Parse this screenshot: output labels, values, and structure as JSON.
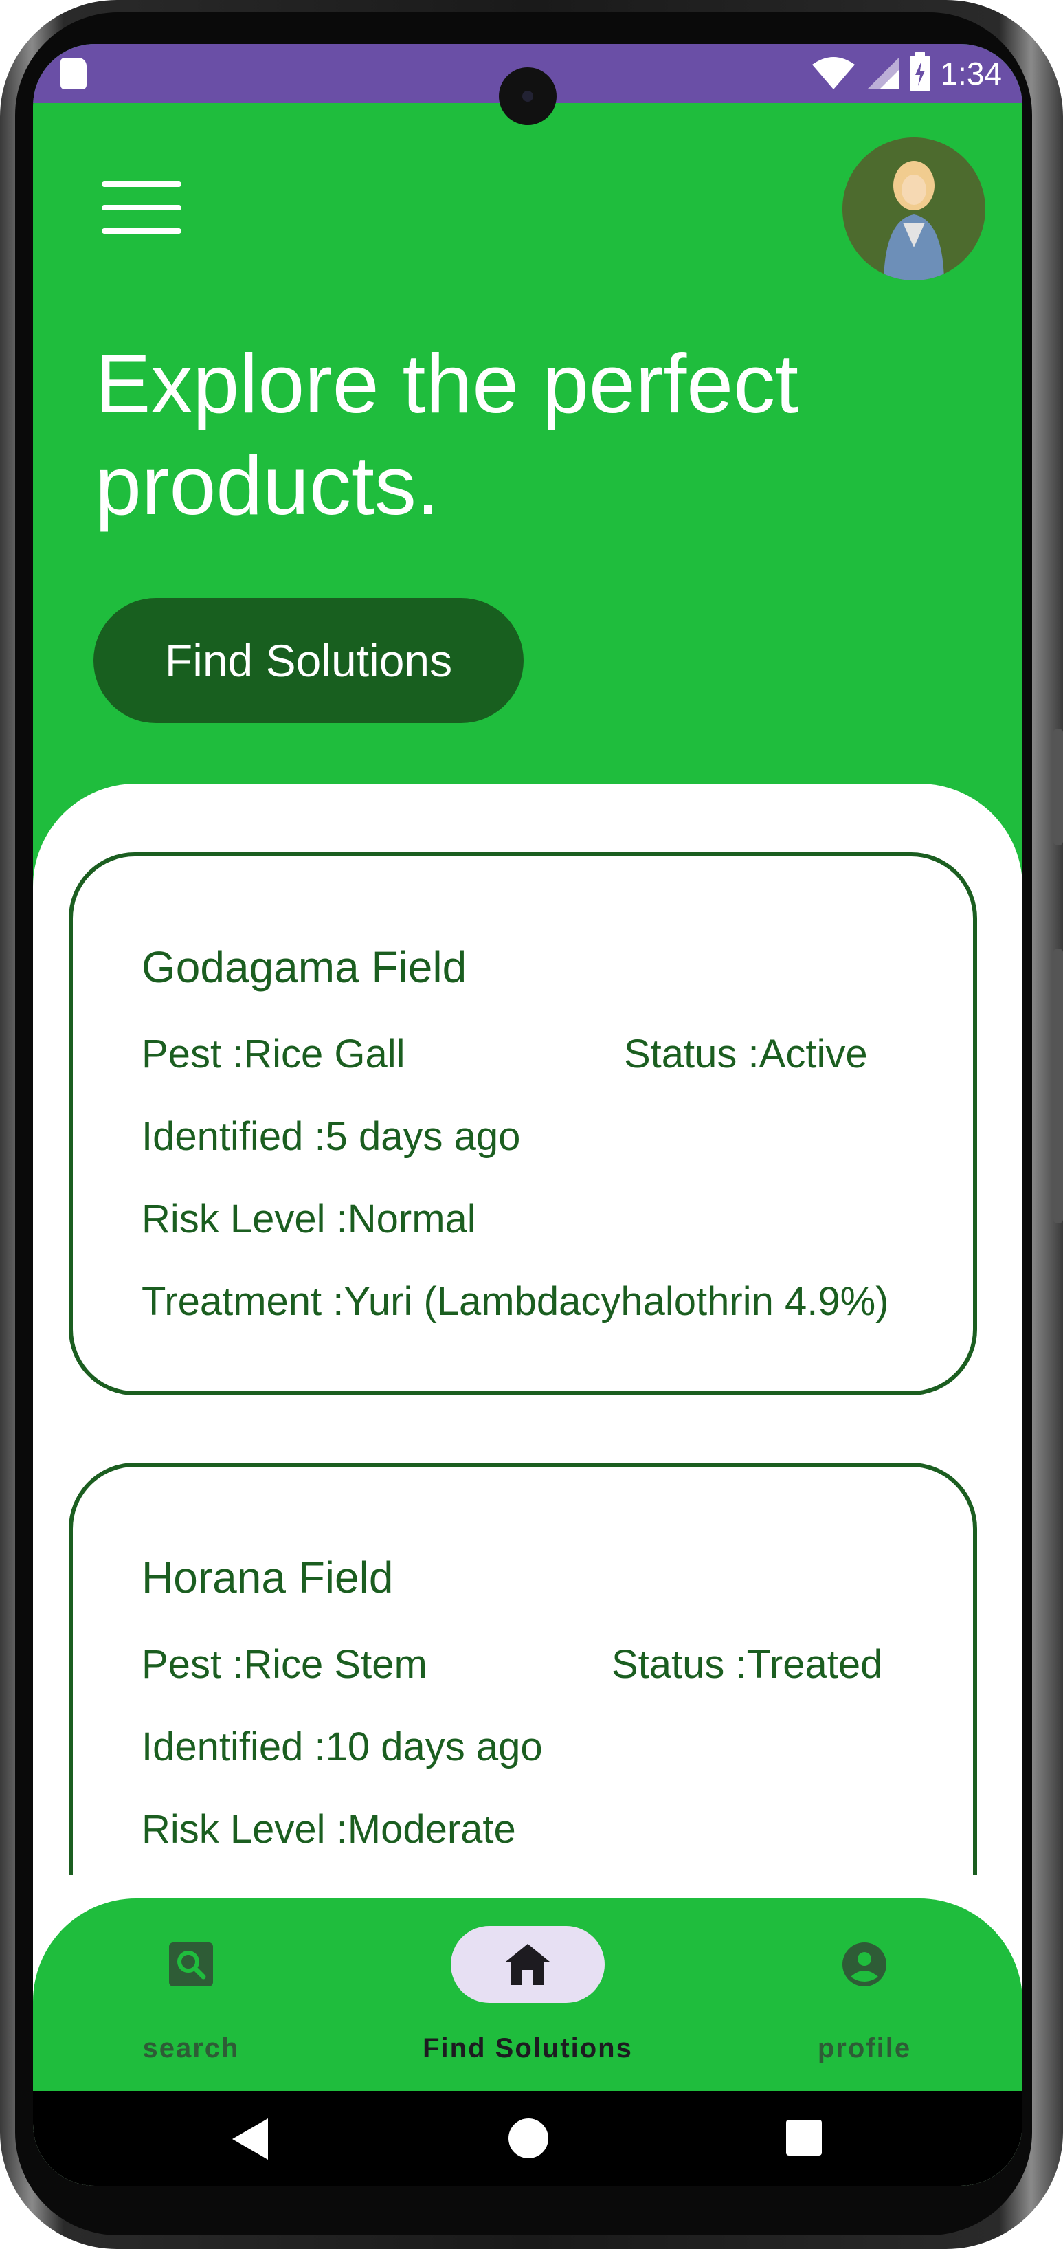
{
  "status_bar": {
    "time": "1:34",
    "icons": [
      "sd-card-icon",
      "wifi-icon",
      "cellular-icon",
      "battery-charging-icon"
    ]
  },
  "header": {
    "menu_icon": "hamburger-menu-icon",
    "headline_line1": "Explore the perfect",
    "headline_line2": "products.",
    "cta_label": "Find Solutions"
  },
  "fields": [
    {
      "name": "Godagama Field",
      "pest": "Pest :Rice Gall",
      "status": "Status :Active",
      "identified": "Identified :5 days ago",
      "risk": "Risk Level :Normal",
      "treatment": "Treatment :Yuri (Lambdacyhalothrin 4.9%)"
    },
    {
      "name": "Horana Field",
      "pest": "Pest :Rice Stem",
      "status": "Status :Treated",
      "identified": "Identified :10 days ago",
      "risk": "Risk Level :Moderate"
    }
  ],
  "bottom_nav": {
    "items": [
      {
        "label": "search",
        "icon": "search-icon",
        "active": false
      },
      {
        "label": "Find Solutions",
        "icon": "home-icon",
        "active": true
      },
      {
        "label": "profile",
        "icon": "account-circle-icon",
        "active": false
      }
    ]
  },
  "colors": {
    "primary_green": "#1fbd3d",
    "dark_green": "#1b5e20",
    "button_green": "#185f1f",
    "status_bar_purple": "#6a4fa6",
    "active_pill": "#e7e0f3",
    "inactive_nav": "#2e5c36"
  }
}
